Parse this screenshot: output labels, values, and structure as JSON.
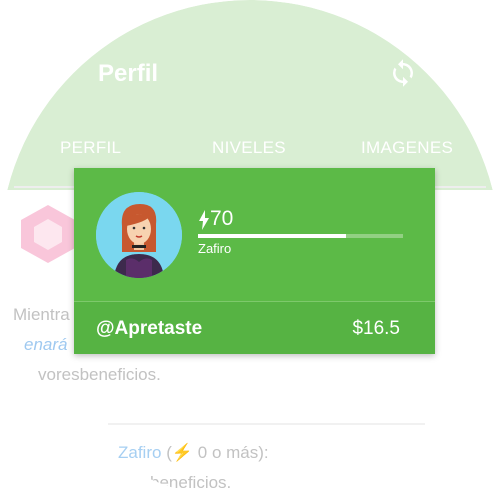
{
  "appbar": {
    "title": "Perfil",
    "refresh_icon": "refresh-icon"
  },
  "tabs": [
    {
      "label": "PERFIL"
    },
    {
      "label": "NIVELES"
    },
    {
      "label": "IMAGENES"
    }
  ],
  "background": {
    "para1_start": "Mientra",
    "para1_link": "enará",
    "para1_end": "voresbeneficios.",
    "zafiro_link": "Zafiro",
    "zafiro_bolt": "⚡",
    "zafiro_rest": "0 o más):",
    "zafiro_open": "(",
    "beneficios": "beneficios."
  },
  "profile_card": {
    "points": "70",
    "level": "Zafiro",
    "progress_percent": 72,
    "username": "@Apretaste",
    "credit": "$16.5",
    "colors": {
      "card": "#5cba47",
      "footer": "#56b343"
    }
  }
}
